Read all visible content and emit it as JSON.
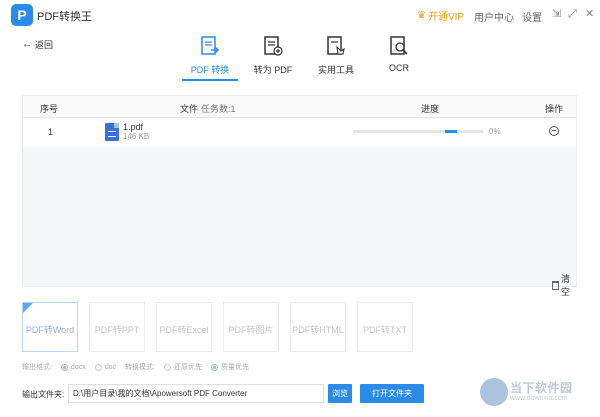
{
  "titlebar": {
    "logo_glyph": "P",
    "title": "PDF转换王",
    "vip_label": "开通VIP",
    "user_center": "用户中心",
    "settings": "设置",
    "minimize_glyph": "⇲",
    "fullscreen_glyph": "⤢",
    "close_glyph": "✕"
  },
  "back": {
    "label": "返回",
    "icon": "arrow-left-icon"
  },
  "tabs": [
    {
      "label": "PDF 转换",
      "icon": "pdf-convert-icon",
      "active": true
    },
    {
      "label": "转为 PDF",
      "icon": "to-pdf-icon",
      "active": false
    },
    {
      "label": "实用工具",
      "icon": "tools-icon",
      "active": false
    },
    {
      "label": "OCR",
      "icon": "ocr-icon",
      "active": false
    }
  ],
  "table": {
    "headers": {
      "index": "序号",
      "file": "文件",
      "task_count": "任务数:1",
      "progress": "进度",
      "action": "操作"
    },
    "rows": [
      {
        "index": "1",
        "name": "1.pdf",
        "size": "146 KB",
        "progress_text": "0%",
        "progress": 0
      }
    ],
    "clear_label": "清空"
  },
  "formats": [
    {
      "label": "PDF转Word",
      "active": true
    },
    {
      "label": "PDF转PPT",
      "active": false
    },
    {
      "label": "PDF转Excel",
      "active": false
    },
    {
      "label": "PDF转图片",
      "active": false
    },
    {
      "label": "PDF转HTML",
      "active": false
    },
    {
      "label": "PDF转TXT",
      "active": false
    }
  ],
  "options": {
    "output_format_label": "输出格式:",
    "format_docx": "docx",
    "format_doc": "doc",
    "mode_label": "转换模式:",
    "mode_fidelity": "还原优先",
    "mode_quality": "质量优先"
  },
  "output": {
    "label": "输出文件夹:",
    "path": "D:\\用户目录\\我的文档\\Apowersoft PDF Converter",
    "browse_label": "浏览",
    "open_label": "打开文件夹"
  },
  "watermark": {
    "text": "当下软件园",
    "sub": "www.downxia.com"
  },
  "colors": {
    "accent": "#2b8be8",
    "vip": "#f39a0e"
  }
}
